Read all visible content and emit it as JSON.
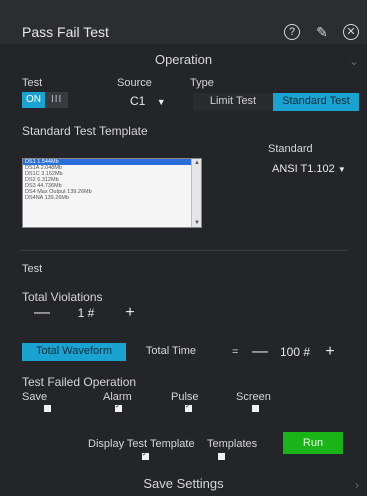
{
  "window": {
    "title": "Pass Fail Test",
    "icons": [
      "help-icon",
      "pin-icon",
      "close-icon"
    ]
  },
  "operation": {
    "header": "Operation",
    "test_label": "Test",
    "test_toggle_on": "ON",
    "test_toggle_off": "III",
    "source_label": "Source",
    "source_value": "C1",
    "type_label": "Type",
    "type_options": [
      "Limit Test",
      "Standard Test"
    ],
    "type_selected": "Standard Test",
    "template_label": "Standard Test Template",
    "template_items": [
      "DS1 1.544Mb",
      "DS1A 2.048Mb",
      "DS1C 3.152Mb",
      "DS2 6.312Mb",
      "DS3 44.736Mb",
      "DS4 Max Output 139.26Mb",
      "DS4NA 139.26Mb"
    ],
    "template_selected_index": 0,
    "standard_label": "Standard",
    "standard_value": "ANSI T1.102",
    "test_section_label": "Test",
    "total_violations_label": "Total Violations",
    "total_violations_value": "1 #",
    "waveform_seg": [
      "Total Waveform",
      "Total Time"
    ],
    "waveform_selected": "Total Waveform",
    "equals": "=",
    "waveform_value": "100 #",
    "failed_operation_label": "Test Failed Operation",
    "failed_checks": [
      {
        "label": "Save",
        "checked": false
      },
      {
        "label": "Alarm",
        "checked": true
      },
      {
        "label": "Pulse",
        "checked": true
      },
      {
        "label": "Screen",
        "checked": false
      }
    ],
    "display_template_label": "Display Test Template",
    "display_template_checked": true,
    "templates_label": "Templates",
    "templates_checked": false,
    "run_label": "Run",
    "minus": "—",
    "plus": "+"
  },
  "footer": {
    "label": "Save Settings"
  },
  "colors": {
    "accent": "#1aa3d1",
    "run_green": "#1ab318",
    "panel_bg": "#242528"
  }
}
